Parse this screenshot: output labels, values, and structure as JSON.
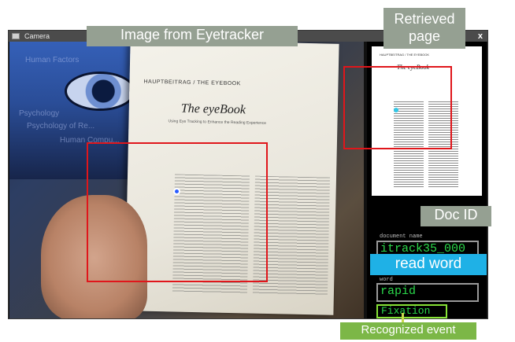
{
  "window": {
    "title": "Camera",
    "close_label": "x"
  },
  "camera_view": {
    "monitor_text": [
      "Human Factors",
      "Psychology",
      "Psychology of Re...",
      "Human Compu..."
    ],
    "paper": {
      "header": "HAUPTBEITRAG / THE EYEBOOK",
      "title": "The eyeBook",
      "subtitle": "Using Eye Tracking to Enhance the Reading Experience"
    }
  },
  "retrieved_page": {
    "header": "HAUPTBEITRAG / THE EYEBOOK",
    "title": "The eyeBook"
  },
  "fields": {
    "document_name_label": "document name",
    "document_name": "itrack35_000",
    "word_label": "word",
    "word": "rapid",
    "event": "Fixation"
  },
  "annotations": {
    "image_from_eyetracker": "Image from Eyetracker",
    "retrieved_page": "Retrieved page",
    "doc_id": "Doc ID",
    "read_word": "read word",
    "recognized_event": "Recognized event"
  },
  "colors": {
    "highlight_red": "#e0161b",
    "terminal_green": "#2ad84a",
    "callout_gray": "#95a092",
    "callout_blue": "#1fb1e6",
    "callout_green": "#7cb747",
    "gaze_blue": "#2a5cff"
  }
}
